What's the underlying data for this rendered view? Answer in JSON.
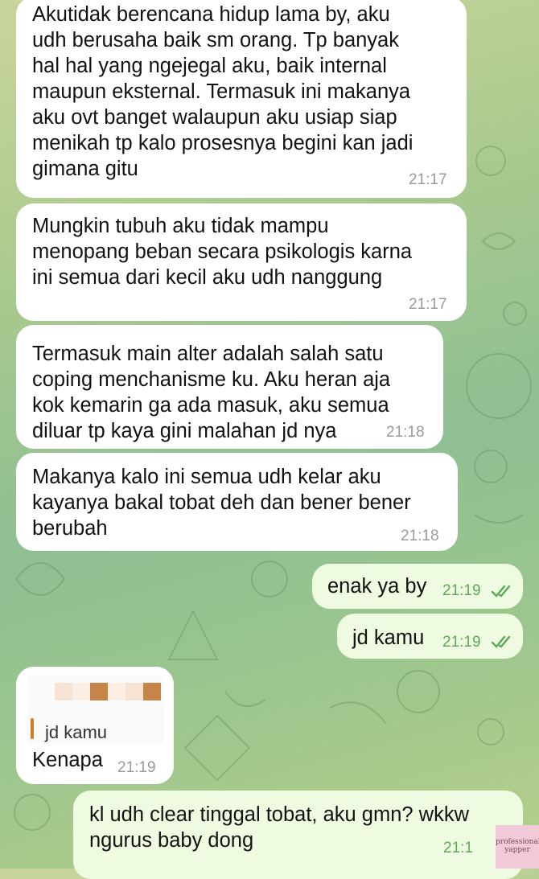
{
  "messages": [
    {
      "direction": "incoming",
      "text": "Akutidak berencana hidup lama by, aku\nudh berusaha baik sm orang. Tp banyak\nhal hal yang ngejegal aku, baik internal\nmaupun eksternal. Termasuk ini makanya\naku ovt banget walaupun aku usiap siap\nmenikah tp kalo prosesnya begini kan jadi\ngimana gitu",
      "time": "21:17"
    },
    {
      "direction": "incoming",
      "text": "Mungkin tubuh aku tidak mampu\nmenopang beban secara psikologis karna\nini semua dari kecil aku udh nanggung",
      "time": "21:17"
    },
    {
      "direction": "incoming",
      "text": "Termasuk main alter adalah salah satu\ncoping menchanisme ku. Aku heran aja\nkok kemarin ga ada masuk, aku semua\ndiluar tp kaya gini malahan jd nya",
      "time": "21:18"
    },
    {
      "direction": "incoming",
      "text": "Makanya kalo ini semua udh kelar aku\nkayanya bakal tobat deh dan bener bener\nberubah",
      "time": "21:18"
    },
    {
      "direction": "outgoing",
      "text": "enak ya by",
      "time": "21:19",
      "status": "read"
    },
    {
      "direction": "outgoing",
      "text": "jd kamu",
      "time": "21:19",
      "status": "read"
    },
    {
      "direction": "incoming",
      "reply_quote": "jd kamu",
      "text": "Kenapa",
      "time": "21:19"
    },
    {
      "direction": "outgoing",
      "text": "kl udh clear tinggal tobat, aku gmn? wkkw\nngurus baby dong",
      "time": "21:1"
    }
  ],
  "watermark": {
    "line1": "professional",
    "line2": "yapper"
  },
  "colors": {
    "incoming_bubble": "#ffffff",
    "outgoing_bubble": "#eefbe1",
    "read_ticks": "#5fa85a",
    "reply_accent": "#d37a2b"
  }
}
